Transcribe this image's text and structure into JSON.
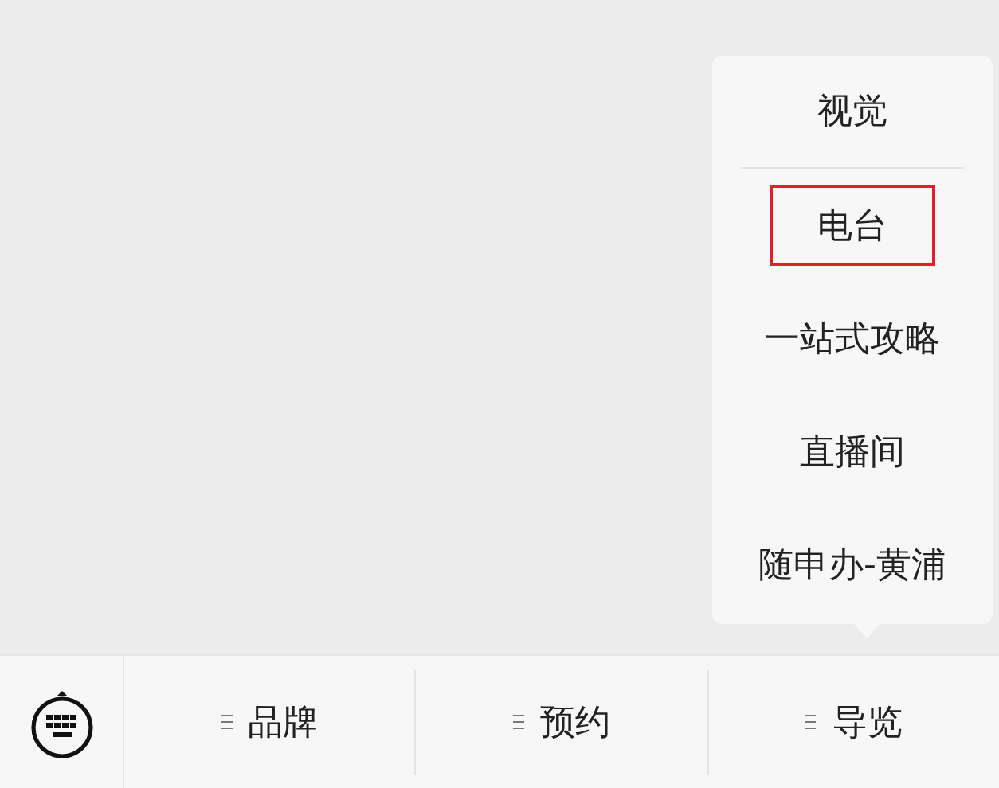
{
  "popup_menu": {
    "items": [
      {
        "label": "视觉",
        "selected": false
      },
      {
        "label": "电台",
        "selected": true
      },
      {
        "label": "一站式攻略",
        "selected": false
      },
      {
        "label": "直播间",
        "selected": false
      },
      {
        "label": "随申办-黄浦",
        "selected": false
      }
    ]
  },
  "menu_bar": {
    "items": [
      {
        "label": "品牌"
      },
      {
        "label": "预约"
      },
      {
        "label": "导览"
      }
    ]
  }
}
